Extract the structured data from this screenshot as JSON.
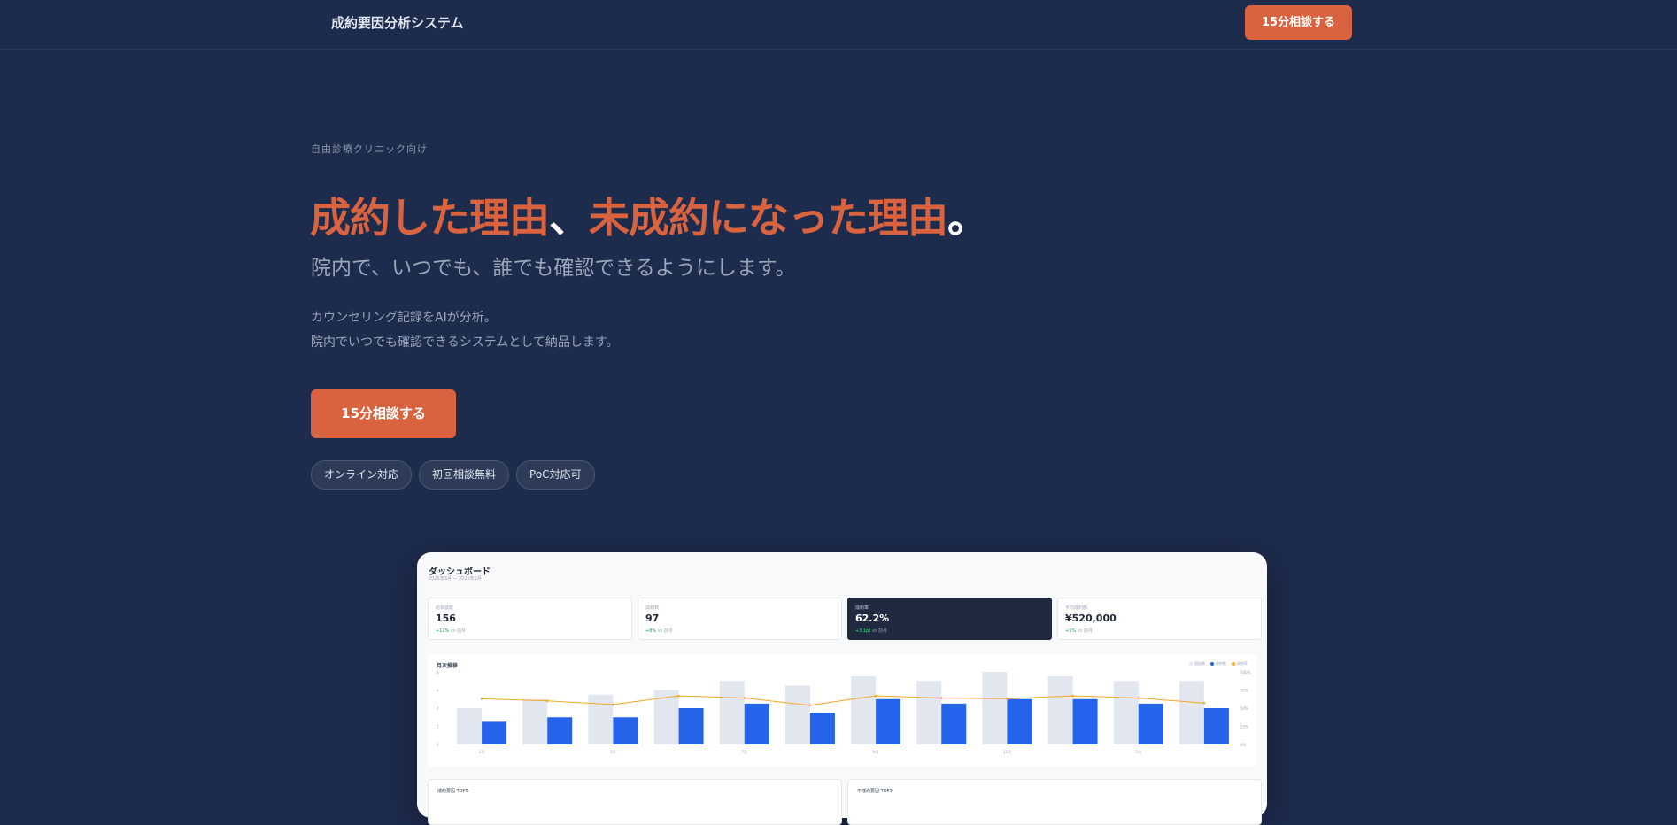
{
  "nav": {
    "brand": "成約要因分析システム",
    "cta_label": "15分相談する"
  },
  "hero": {
    "eyebrow": "自由診療クリニック向け",
    "headline_part1": "成約した理由",
    "headline_sep": "、",
    "headline_part2": "未成約になった理由",
    "headline_end": "。",
    "subheadline": "院内で、いつでも、誰でも確認できるようにします。",
    "body_line1": "カウンセリング記録をAIが分析。",
    "body_line2": "院内でいつでも確認できるシステムとして納品します。",
    "cta_label": "15分相談する",
    "chips": [
      "オンライン対応",
      "初回相談無料",
      "PoC対応可"
    ]
  },
  "dashboard": {
    "title": "ダッシュボード",
    "period": "2025年3月 — 2026年2月",
    "kpis": [
      {
        "label": "総相談数",
        "value": "156",
        "delta": "+12%",
        "delta_suffix": "vs 前月"
      },
      {
        "label": "成約数",
        "value": "97",
        "delta": "+8%",
        "delta_suffix": "vs 前月"
      },
      {
        "label": "成約率",
        "value": "62.2%",
        "delta": "+3.1pt",
        "delta_suffix": "vs 前月"
      },
      {
        "label": "平均成約額",
        "value": "¥520,000",
        "delta": "+5%",
        "delta_suffix": "vs 前月"
      }
    ],
    "chart_title": "月次推移",
    "legend": [
      "相談数",
      "成約数",
      "成約率"
    ],
    "bottom_left_title": "成約要因 TOP5",
    "bottom_right_title": "不成約要因 TOP5"
  },
  "colors": {
    "background": "#1d2b4d",
    "accent": "#d9623f",
    "bar_consult": "#e2e6ee",
    "bar_closed": "#2563eb",
    "line_rate": "#f5a524"
  },
  "chart_data": {
    "type": "bar",
    "categories": [
      "",
      "",
      "",
      "",
      "",
      "",
      "",
      "",
      "",
      "",
      "",
      ""
    ],
    "x_tick_labels": [
      "3月",
      "5月",
      "7月",
      "9月",
      "11月",
      "1月"
    ],
    "y_ticks": [
      "0",
      "2",
      "4",
      "6",
      "8"
    ],
    "y2_ticks": [
      "0%",
      "25%",
      "50%",
      "75%",
      "100%"
    ],
    "ylim": [
      0,
      8
    ],
    "y2lim": [
      0,
      100
    ],
    "series": [
      {
        "name": "相談数",
        "values": [
          4,
          5,
          5.5,
          6,
          7,
          6.5,
          7.5,
          7,
          8,
          7.5,
          7,
          7
        ]
      },
      {
        "name": "成約数",
        "values": [
          2.5,
          3,
          3,
          4,
          4.5,
          3.5,
          5,
          4.5,
          5,
          5,
          4.5,
          4
        ]
      },
      {
        "name": "成約率",
        "values": [
          63,
          60,
          55,
          67,
          64,
          54,
          67,
          64,
          63,
          67,
          64,
          57
        ]
      }
    ],
    "grid": false,
    "legend_position": "top-right"
  }
}
